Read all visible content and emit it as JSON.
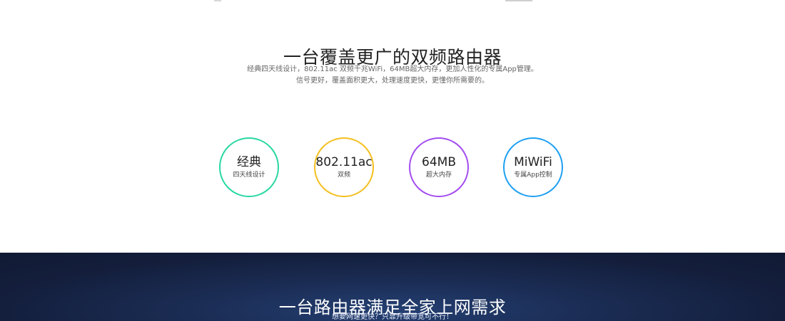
{
  "top": {
    "title": "一台覆盖更广的双频路由器",
    "description_line_1": "经典四天线设计，802.11ac 双频千兆WiFi，64MB超大内存，更加人性化的专属App管理。",
    "description_line_2": "信号更好，覆盖面积更大，处理速度更快，更懂你所需要的。"
  },
  "features": [
    {
      "title": "经典",
      "subtitle": "四天线设计",
      "color": "#28d8a1"
    },
    {
      "title": "802.11ac",
      "subtitle": "双频",
      "color": "#f4bf1f"
    },
    {
      "title": "64MB",
      "subtitle": "超大内存",
      "color": "#a34df0"
    },
    {
      "title": "MiWiFi",
      "subtitle": "专属App控制",
      "color": "#1ea0f2"
    }
  ],
  "bottom": {
    "title": "一台路由器满足全家上网需求",
    "subtitle": "想要网速更快？只靠升级带宽可不行！"
  }
}
